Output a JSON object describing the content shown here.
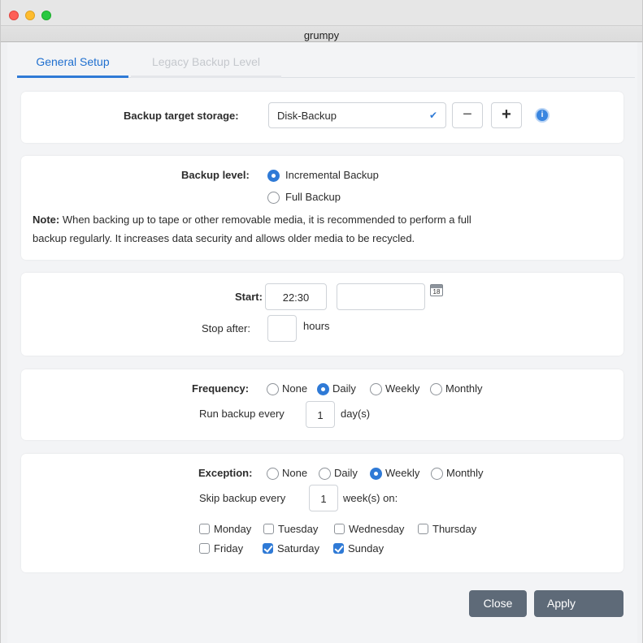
{
  "window": {
    "title": "grumpy"
  },
  "tabs": [
    {
      "label": "General Setup",
      "active": true
    },
    {
      "label": "Legacy Backup Level",
      "active": false
    }
  ],
  "storage": {
    "label": "Backup target storage:",
    "value": "Disk-Backup",
    "remove_symbol": "−",
    "add_symbol": "+"
  },
  "backup_level": {
    "label": "Backup level:",
    "options": [
      "Incremental Backup",
      "Full Backup"
    ],
    "selected": "Incremental Backup",
    "note_label": "Note:",
    "note_line1": " When backing up to tape or other removable media, it is recommended to perform a full",
    "note_line2": "backup regularly. It increases data security and allows older media to be recycled."
  },
  "start": {
    "label": "Start:",
    "time": "22:30",
    "date": "",
    "calendar_day": "18",
    "stop_label": "Stop after:",
    "stop_value": "",
    "stop_unit": "hours"
  },
  "frequency": {
    "label": "Frequency:",
    "options": [
      "None",
      "Daily",
      "Weekly",
      "Monthly"
    ],
    "selected": "Daily",
    "run_label": "Run backup every",
    "run_value": "1",
    "run_unit": "day(s)"
  },
  "exception": {
    "label": "Exception:",
    "options": [
      "None",
      "Daily",
      "Weekly",
      "Monthly"
    ],
    "selected": "Weekly",
    "skip_label": "Skip backup every",
    "skip_value": "1",
    "skip_unit": "week(s) on:",
    "days": [
      {
        "label": "Monday",
        "checked": false
      },
      {
        "label": "Tuesday",
        "checked": false
      },
      {
        "label": "Wednesday",
        "checked": false
      },
      {
        "label": "Thursday",
        "checked": false
      },
      {
        "label": "Friday",
        "checked": false
      },
      {
        "label": "Saturday",
        "checked": true
      },
      {
        "label": "Sunday",
        "checked": true
      }
    ]
  },
  "footer": {
    "close_label": "Close",
    "apply_label": "Apply"
  },
  "colors": {
    "accent": "#2f7ad6",
    "button": "#5e6a78",
    "panel": "#ffffff",
    "background": "#f3f4f6"
  },
  "icons": [
    "info-icon",
    "calendar-icon",
    "chevron-down-icon",
    "minus-icon",
    "plus-icon"
  ]
}
